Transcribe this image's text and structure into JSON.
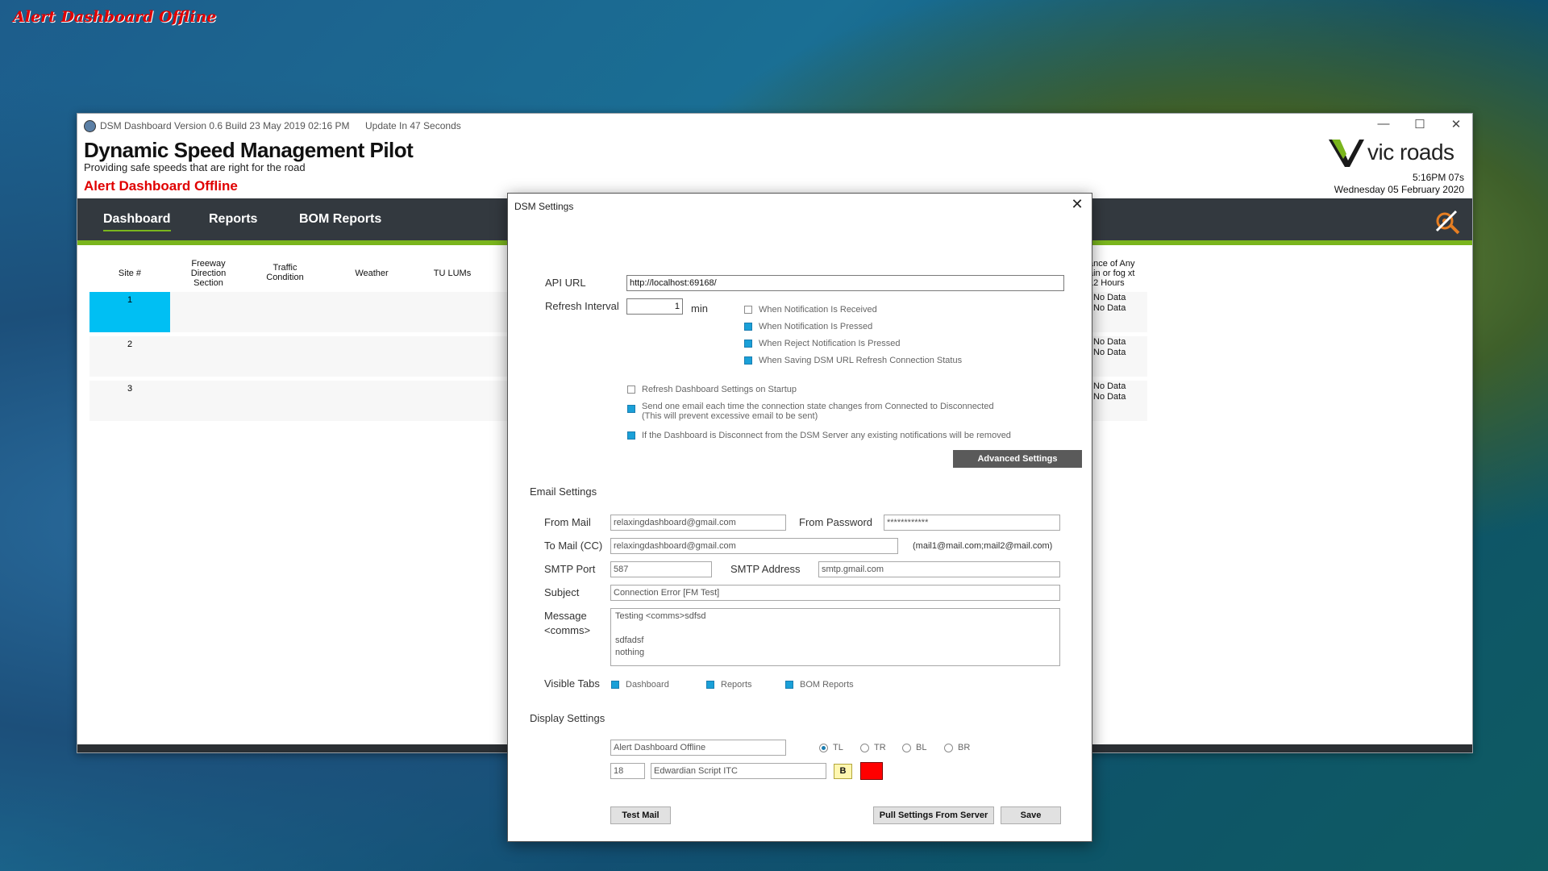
{
  "overlay_alert": "Alert Dashboard Offline",
  "window": {
    "version": "DSM Dashboard Version 0.6 Build 23 May 2019 02:16 PM",
    "update": "Update In 47 Seconds",
    "title": "Dynamic Speed Management Pilot",
    "subtitle": "Providing safe speeds that are right for the road",
    "alert": "Alert Dashboard Offline",
    "logo_text": "vic roads",
    "time": "5:16PM 07s",
    "date": "Wednesday 05 February 2020",
    "controls": {
      "minimize": "—",
      "maximize": "☐",
      "close": "✕"
    }
  },
  "nav": {
    "tabs": [
      "Dashboard",
      "Reports",
      "BOM Reports"
    ],
    "active": "Dashboard"
  },
  "table": {
    "headers": [
      "Site #",
      "Freeway Direction Section",
      "Traffic Condition",
      "Weather",
      "TU LUMs"
    ],
    "right_header": "ance of Any ain or fog xt 12 Hours",
    "rows": [
      {
        "site": "1",
        "d1": "No Data",
        "d2": "No Data",
        "highlight": true
      },
      {
        "site": "2",
        "d1": "No Data",
        "d2": "No Data"
      },
      {
        "site": "3",
        "d1": "No Data",
        "d2": "No Data"
      }
    ]
  },
  "dialog": {
    "title": "DSM Settings",
    "close": "✕",
    "api_url_label": "API URL",
    "api_url": "http://localhost:69168/",
    "refresh_label": "Refresh Interval",
    "refresh_value": "1",
    "refresh_unit": "min",
    "refresh_options": [
      {
        "label": "When Notification Is Received",
        "checked": false
      },
      {
        "label": "When Notification Is Pressed",
        "checked": true
      },
      {
        "label": "When Reject Notification Is Pressed",
        "checked": true
      },
      {
        "label": "When Saving DSM URL Refresh Connection Status",
        "checked": true
      }
    ],
    "opt_startup": "Refresh Dashboard Settings on Startup",
    "opt_email_once": "Send one email each time the connection state changes from Connected to Disconnected",
    "opt_email_once_note": "(This will prevent excessive email to be sent)",
    "opt_disconnect": "If the Dashboard is Disconnect from the DSM Server any existing notifications will be removed",
    "advanced_btn": "Advanced Settings",
    "email_section": "Email Settings",
    "from_mail_label": "From Mail",
    "from_mail": "relaxingdashboard@gmail.com",
    "from_pwd_label": "From Password",
    "from_pwd": "************",
    "to_mail_label": "To Mail (CC)",
    "to_mail": "relaxingdashboard@gmail.com",
    "to_mail_hint": "(mail1@mail.com;mail2@mail.com)",
    "smtp_port_label": "SMTP Port",
    "smtp_port": "587",
    "smtp_addr_label": "SMTP Address",
    "smtp_addr": "smtp.gmail.com",
    "subject_label": "Subject",
    "subject": "Connection Error [FM Test]",
    "message_label": "Message",
    "message_label2": "<comms>",
    "message": "Testing <comms>sdfsd\n\nsdfadsf\nnothing",
    "visible_tabs_label": "Visible Tabs",
    "visible_tabs": [
      "Dashboard",
      "Reports",
      "BOM Reports"
    ],
    "display_section": "Display Settings",
    "display_text": "Alert Dashboard Offline",
    "positions": [
      "TL",
      "TR",
      "BL",
      "BR"
    ],
    "position_selected": "TL",
    "font_size": "18",
    "font_name": "Edwardian Script ITC",
    "bold_btn": "B",
    "color": "#ff0000",
    "test_mail_btn": "Test Mail",
    "pull_btn": "Pull Settings From Server",
    "save_btn": "Save"
  }
}
